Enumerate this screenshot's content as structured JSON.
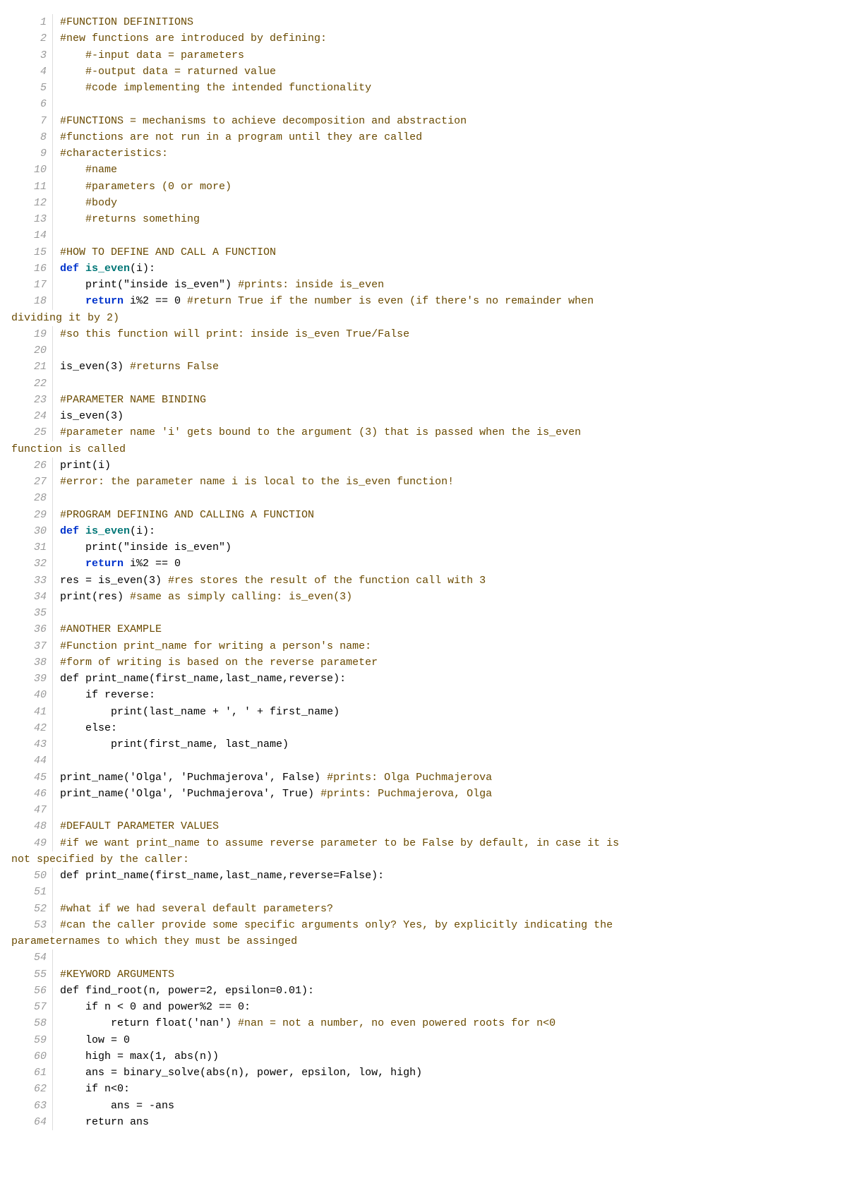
{
  "lines": [
    {
      "n": 1,
      "segs": [
        {
          "t": "#FUNCTION DEFINITIONS",
          "cls": "c-comment"
        }
      ]
    },
    {
      "n": 2,
      "segs": [
        {
          "t": "#new functions are introduced by defining:",
          "cls": "c-comment"
        }
      ]
    },
    {
      "n": 3,
      "segs": [
        {
          "t": "    "
        },
        {
          "t": "#-input data = parameters",
          "cls": "c-comment"
        }
      ]
    },
    {
      "n": 4,
      "segs": [
        {
          "t": "    "
        },
        {
          "t": "#-output data = raturned value",
          "cls": "c-comment"
        }
      ]
    },
    {
      "n": 5,
      "segs": [
        {
          "t": "    "
        },
        {
          "t": "#code implementing the intended functionality",
          "cls": "c-comment"
        }
      ]
    },
    {
      "n": 6,
      "segs": [
        {
          "t": ""
        }
      ]
    },
    {
      "n": 7,
      "segs": [
        {
          "t": "#FUNCTIONS = mechanisms to achieve decomposition and abstraction",
          "cls": "c-comment"
        }
      ]
    },
    {
      "n": 8,
      "segs": [
        {
          "t": "#functions are not run in a program until they are called",
          "cls": "c-comment"
        }
      ]
    },
    {
      "n": 9,
      "segs": [
        {
          "t": "#characteristics:",
          "cls": "c-comment"
        }
      ]
    },
    {
      "n": 10,
      "segs": [
        {
          "t": "    "
        },
        {
          "t": "#name",
          "cls": "c-comment"
        }
      ]
    },
    {
      "n": 11,
      "segs": [
        {
          "t": "    "
        },
        {
          "t": "#parameters (0 or more)",
          "cls": "c-comment"
        }
      ]
    },
    {
      "n": 12,
      "segs": [
        {
          "t": "    "
        },
        {
          "t": "#body",
          "cls": "c-comment"
        }
      ]
    },
    {
      "n": 13,
      "segs": [
        {
          "t": "    "
        },
        {
          "t": "#returns something",
          "cls": "c-comment"
        }
      ]
    },
    {
      "n": 14,
      "segs": [
        {
          "t": ""
        }
      ]
    },
    {
      "n": 15,
      "segs": [
        {
          "t": "#HOW TO DEFINE AND CALL A FUNCTION",
          "cls": "c-comment"
        }
      ]
    },
    {
      "n": 16,
      "segs": [
        {
          "t": "def ",
          "cls": "c-kw"
        },
        {
          "t": "is_even",
          "cls": "c-fn"
        },
        {
          "t": "(i):"
        }
      ]
    },
    {
      "n": 17,
      "segs": [
        {
          "t": "    print(\"inside is_even\") "
        },
        {
          "t": "#prints: inside is_even",
          "cls": "c-comment"
        }
      ]
    },
    {
      "n": 18,
      "segs": [
        {
          "t": "    "
        },
        {
          "t": "return",
          "cls": "c-kw"
        },
        {
          "t": " i%2 == 0 "
        },
        {
          "t": "#return True if the number is even (if there's no remainder when ",
          "cls": "c-comment"
        }
      ],
      "wrap": "dividing it by 2)"
    },
    {
      "n": 19,
      "segs": [
        {
          "t": "#so this function will print: inside is_even True/False",
          "cls": "c-comment"
        }
      ]
    },
    {
      "n": 20,
      "segs": [
        {
          "t": ""
        }
      ]
    },
    {
      "n": 21,
      "segs": [
        {
          "t": "is_even(3) "
        },
        {
          "t": "#returns False",
          "cls": "c-comment"
        }
      ]
    },
    {
      "n": 22,
      "segs": [
        {
          "t": ""
        }
      ]
    },
    {
      "n": 23,
      "segs": [
        {
          "t": "#PARAMETER NAME BINDING",
          "cls": "c-comment"
        }
      ]
    },
    {
      "n": 24,
      "segs": [
        {
          "t": "is_even(3)"
        }
      ]
    },
    {
      "n": 25,
      "segs": [
        {
          "t": "#parameter name 'i' gets bound to the argument (3) that is passed when the is_even ",
          "cls": "c-comment"
        }
      ],
      "wrap": "function is called"
    },
    {
      "n": 26,
      "segs": [
        {
          "t": "print(i)"
        }
      ]
    },
    {
      "n": 27,
      "segs": [
        {
          "t": "#error: the parameter name i is local to the is_even function!",
          "cls": "c-comment"
        }
      ]
    },
    {
      "n": 28,
      "segs": [
        {
          "t": ""
        }
      ]
    },
    {
      "n": 29,
      "segs": [
        {
          "t": "#PROGRAM DEFINING AND CALLING A FUNCTION",
          "cls": "c-comment"
        }
      ]
    },
    {
      "n": 30,
      "segs": [
        {
          "t": "def ",
          "cls": "c-kw"
        },
        {
          "t": "is_even",
          "cls": "c-fn"
        },
        {
          "t": "(i):"
        }
      ]
    },
    {
      "n": 31,
      "segs": [
        {
          "t": "    print(\"inside is_even\")"
        }
      ]
    },
    {
      "n": 32,
      "segs": [
        {
          "t": "    "
        },
        {
          "t": "return",
          "cls": "c-kw"
        },
        {
          "t": " i%2 == 0"
        }
      ]
    },
    {
      "n": 33,
      "segs": [
        {
          "t": "res = is_even(3) "
        },
        {
          "t": "#res stores the result of the function call with 3",
          "cls": "c-comment"
        }
      ]
    },
    {
      "n": 34,
      "segs": [
        {
          "t": "print(res) "
        },
        {
          "t": "#same as simply calling: is_even(3)",
          "cls": "c-comment"
        }
      ]
    },
    {
      "n": 35,
      "segs": [
        {
          "t": ""
        }
      ]
    },
    {
      "n": 36,
      "segs": [
        {
          "t": "#ANOTHER EXAMPLE",
          "cls": "c-comment"
        }
      ]
    },
    {
      "n": 37,
      "segs": [
        {
          "t": "#Function print_name for writing a person's name:",
          "cls": "c-comment"
        }
      ]
    },
    {
      "n": 38,
      "segs": [
        {
          "t": "#form of writing is based on the reverse parameter",
          "cls": "c-comment"
        }
      ]
    },
    {
      "n": 39,
      "segs": [
        {
          "t": "def print_name(first_name,last_name,reverse):"
        }
      ]
    },
    {
      "n": 40,
      "segs": [
        {
          "t": "    if reverse:"
        }
      ]
    },
    {
      "n": 41,
      "segs": [
        {
          "t": "        print(last_name + ', ' + first_name)"
        }
      ]
    },
    {
      "n": 42,
      "segs": [
        {
          "t": "    else:"
        }
      ]
    },
    {
      "n": 43,
      "segs": [
        {
          "t": "        print(first_name, last_name)"
        }
      ]
    },
    {
      "n": 44,
      "segs": [
        {
          "t": ""
        }
      ]
    },
    {
      "n": 45,
      "segs": [
        {
          "t": "print_name('Olga', 'Puchmajerova', False) "
        },
        {
          "t": "#prints: Olga Puchmajerova",
          "cls": "c-comment"
        }
      ]
    },
    {
      "n": 46,
      "segs": [
        {
          "t": "print_name('Olga', 'Puchmajerova', True) "
        },
        {
          "t": "#prints: Puchmajerova, Olga",
          "cls": "c-comment"
        }
      ]
    },
    {
      "n": 47,
      "segs": [
        {
          "t": ""
        }
      ]
    },
    {
      "n": 48,
      "segs": [
        {
          "t": "#DEFAULT PARAMETER VALUES",
          "cls": "c-comment"
        }
      ]
    },
    {
      "n": 49,
      "segs": [
        {
          "t": "#if we want print_name to assume reverse parameter to be False by default, in case it is ",
          "cls": "c-comment"
        }
      ],
      "wrap": "not specified by the caller:"
    },
    {
      "n": 50,
      "segs": [
        {
          "t": "def print_name(first_name,last_name,reverse=False):"
        }
      ]
    },
    {
      "n": 51,
      "segs": [
        {
          "t": ""
        }
      ]
    },
    {
      "n": 52,
      "segs": [
        {
          "t": "#what if we had several default parameters?",
          "cls": "c-comment"
        }
      ]
    },
    {
      "n": 53,
      "segs": [
        {
          "t": "#can the caller provide some specific arguments only? Yes, by explicitly indicating the ",
          "cls": "c-comment"
        }
      ],
      "wrap": "parameternames to which they must be assinged"
    },
    {
      "n": 54,
      "segs": [
        {
          "t": ""
        }
      ]
    },
    {
      "n": 55,
      "segs": [
        {
          "t": "#KEYWORD ARGUMENTS",
          "cls": "c-comment"
        }
      ]
    },
    {
      "n": 56,
      "segs": [
        {
          "t": "def find_root(n, power=2, epsilon=0.01):"
        }
      ]
    },
    {
      "n": 57,
      "segs": [
        {
          "t": "    if n < 0 and power%2 == 0:"
        }
      ]
    },
    {
      "n": 58,
      "segs": [
        {
          "t": "        return float('nan') "
        },
        {
          "t": "#nan = not a number, no even powered roots for n<0",
          "cls": "c-comment"
        }
      ]
    },
    {
      "n": 59,
      "segs": [
        {
          "t": "    low = 0"
        }
      ]
    },
    {
      "n": 60,
      "segs": [
        {
          "t": "    high = max(1, abs(n))"
        }
      ]
    },
    {
      "n": 61,
      "segs": [
        {
          "t": "    ans = binary_solve(abs(n), power, epsilon, low, high)"
        }
      ]
    },
    {
      "n": 62,
      "segs": [
        {
          "t": "    if n<0:"
        }
      ]
    },
    {
      "n": 63,
      "segs": [
        {
          "t": "        ans = -ans"
        }
      ]
    },
    {
      "n": 64,
      "segs": [
        {
          "t": "    return ans"
        }
      ]
    }
  ]
}
